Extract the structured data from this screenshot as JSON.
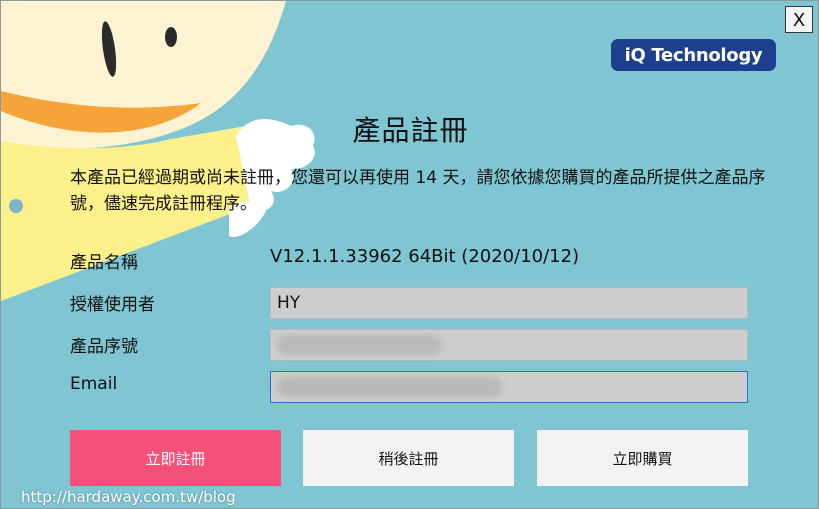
{
  "window": {
    "close_label": "X"
  },
  "brand": {
    "logo_text": "iQ Technology"
  },
  "dialog": {
    "title": "產品註冊",
    "description": "本產品已經過期或尚未註冊，您還可以再使用 14 天，請您依據您購買的產品所提供之產品序號，儘速完成註冊程序。",
    "product_name_label": "產品名稱",
    "product_version": "V12.1.1.33962 64Bit (2020/10/12)",
    "user_label": "授權使用者",
    "user_value": "HY",
    "serial_label": "產品序號",
    "email_label": "Email"
  },
  "buttons": {
    "register_now": "立即註冊",
    "register_later": "稍後註冊",
    "buy_now": "立即購買"
  },
  "watermark": "http://hardaway.com.tw/blog",
  "colors": {
    "background": "#7fc5d2",
    "primary_button": "#f5507a",
    "brand_badge": "#1d3f8e"
  }
}
